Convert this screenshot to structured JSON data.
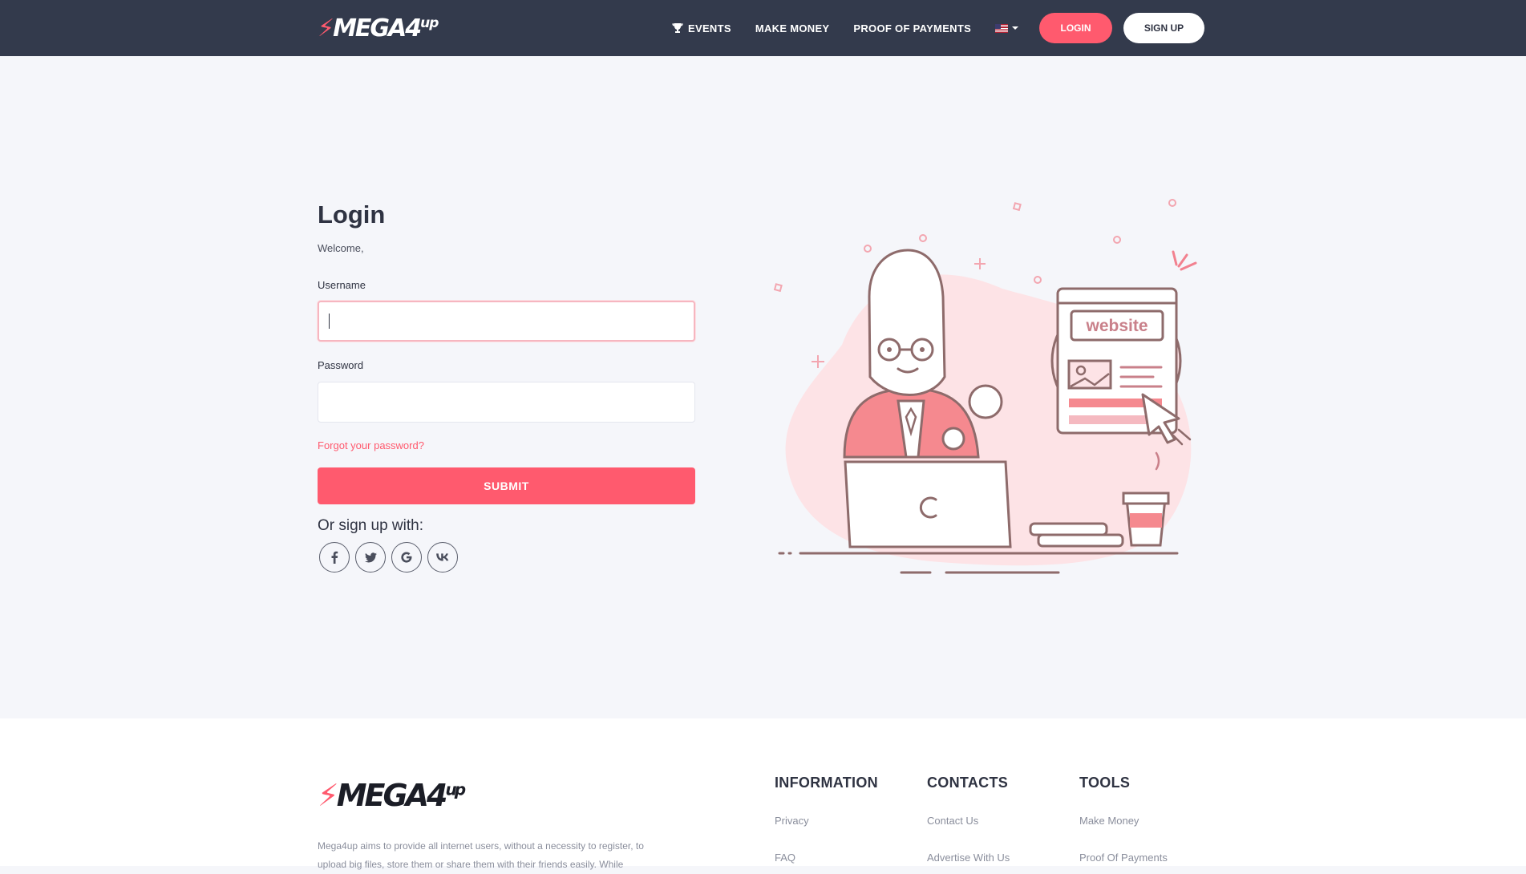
{
  "nav": {
    "logo_main": "MEGA4",
    "logo_sup": "up",
    "links": {
      "events": "EVENTS",
      "make_money": "MAKE MONEY",
      "proof": "PROOF OF PAYMENTS"
    },
    "login": "LOGIN",
    "signup": "SIGN UP"
  },
  "form": {
    "title": "Login",
    "welcome": "Welcome,",
    "username_label": "Username",
    "username_value": "",
    "password_label": "Password",
    "password_value": "",
    "forgot": "Forgot your password?",
    "submit": "SUBMIT",
    "or_signup": "Or sign up with:",
    "socials": [
      "facebook",
      "twitter",
      "google",
      "vk"
    ]
  },
  "illustration": {
    "website_label": "website"
  },
  "footer": {
    "logo_main": "MEGA4",
    "logo_sup": "up",
    "description": "Mega4up aims to provide all internet users, without a necessity to register, to upload big files, store them or share them with their friends easily. While",
    "information": {
      "title": "INFORMATION",
      "links": [
        "Privacy",
        "FAQ"
      ]
    },
    "contacts": {
      "title": "CONTACTS",
      "links": [
        "Contact Us",
        "Advertise With Us"
      ]
    },
    "tools": {
      "title": "TOOLS",
      "links": [
        "Make Money",
        "Proof Of Payments"
      ]
    }
  },
  "colors": {
    "accent": "#ff5a6e",
    "navbar": "#333a4c",
    "page_bg": "#f5f6fa"
  }
}
